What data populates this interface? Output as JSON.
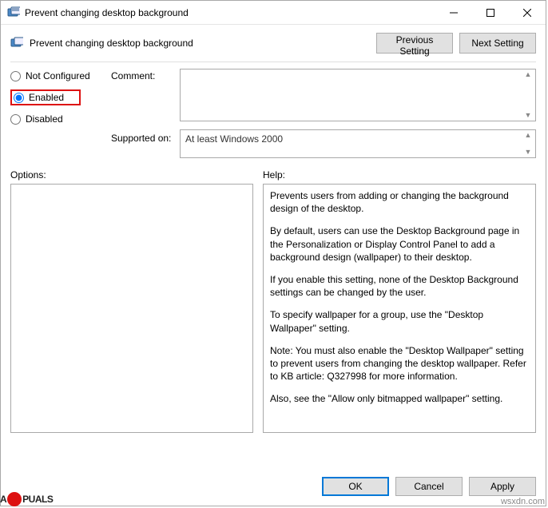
{
  "titlebar": {
    "title": "Prevent changing desktop background"
  },
  "toprow": {
    "title": "Prevent changing desktop background",
    "prev": "Previous Setting",
    "next": "Next Setting"
  },
  "radios": {
    "not_configured": "Not Configured",
    "enabled": "Enabled",
    "disabled": "Disabled"
  },
  "labels": {
    "comment": "Comment:",
    "supported": "Supported on:",
    "options": "Options:",
    "help": "Help:"
  },
  "supported_text": "At least Windows 2000",
  "help_paragraphs": [
    "Prevents users from adding or changing the background design of the desktop.",
    "By default, users can use the Desktop Background page in the Personalization or Display Control Panel to add a background design (wallpaper) to their desktop.",
    "If you enable this setting, none of the Desktop Background settings can be changed by the user.",
    "To specify wallpaper for a group, use the \"Desktop Wallpaper\" setting.",
    "Note: You must also enable the \"Desktop Wallpaper\" setting to prevent users from changing the desktop wallpaper. Refer to KB article: Q327998 for more information.",
    "Also, see the \"Allow only bitmapped wallpaper\" setting."
  ],
  "buttons": {
    "ok": "OK",
    "cancel": "Cancel",
    "apply": "Apply"
  },
  "watermark": {
    "logo_left": "A",
    "logo_right": "PUALS",
    "url": "wsxdn.com"
  }
}
